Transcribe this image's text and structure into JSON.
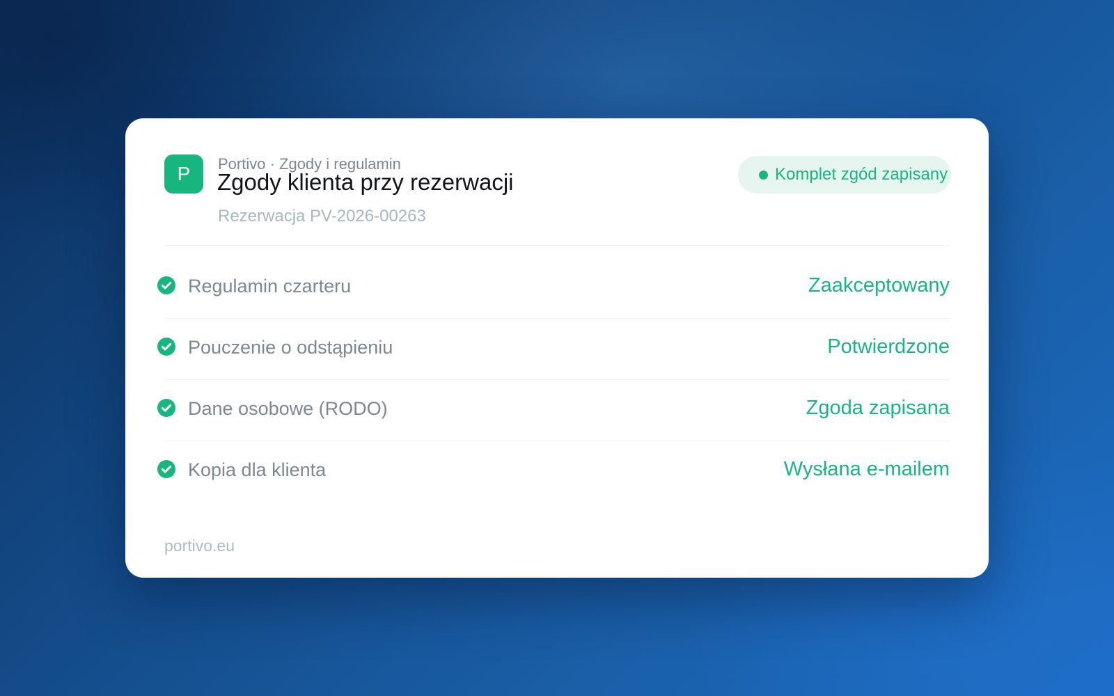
{
  "card": {
    "logo_letter": "P",
    "eyebrow": "Portivo · Zgody i regulamin",
    "title": "Zgody klienta przy rezerwacji",
    "subtitle": "Rezerwacja PV-2026-00263",
    "status": {
      "label": "Komplet zgód zapisany",
      "color": "#18b67f",
      "icon": "dot-icon"
    },
    "items": [
      {
        "label": "Regulamin czarteru",
        "value": "Zaakceptowany",
        "icon": "check-circle-icon"
      },
      {
        "label": "Pouczenie o odstąpieniu",
        "value": "Potwierdzone",
        "icon": "check-circle-icon"
      },
      {
        "label": "Dane osobowe (RODO)",
        "value": "Zgoda zapisana",
        "icon": "check-circle-icon"
      },
      {
        "label": "Kopia dla klienta",
        "value": "Wysłana e-mailem",
        "icon": "check-circle-icon"
      }
    ],
    "footer": "portivo.eu"
  },
  "colors": {
    "accent": "#18b67f",
    "accent_bg": "#e6f5ef",
    "background_from": "#0c2f5c",
    "background_to": "#1c6cc4"
  }
}
